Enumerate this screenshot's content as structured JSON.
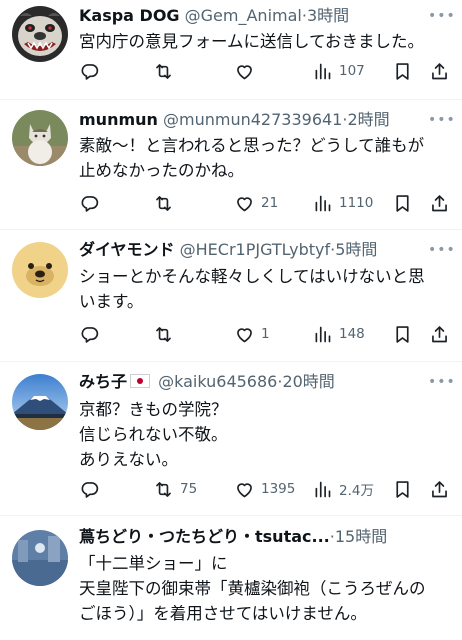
{
  "tweets": [
    {
      "display_name": "Kaspa DOG",
      "handle": "@Gem_Animal",
      "time": "3時間",
      "lines": [
        "宮内庁の意見フォームに送信しておきました。"
      ],
      "replies": "",
      "retweets": "",
      "likes": "",
      "views": "107",
      "avatar": "bulldog-avatar"
    },
    {
      "display_name": "munmun",
      "handle": "@munmun427339641",
      "time": "2時間",
      "lines": [
        "素敵〜！と言われると思った？どうして誰もが",
        "止めなかったのかね。"
      ],
      "replies": "",
      "retweets": "",
      "likes": "21",
      "views": "1110",
      "avatar": "cat-avatar"
    },
    {
      "display_name": "ダイヤモンド",
      "handle": "@HECr1PJGTLybtyf",
      "time": "5時間",
      "lines": [
        "ショーとかそんな軽々しくしてはいけないと思",
        "います。"
      ],
      "replies": "",
      "retweets": "",
      "likes": "1",
      "views": "148",
      "avatar": "bear-avatar"
    },
    {
      "display_name": "みち子",
      "flag": "japan-flag",
      "handle": "@kaiku645686",
      "time": "20時間",
      "lines": [
        "京都？きもの学院？",
        "信じられない不敬。",
        "ありえない。"
      ],
      "replies": "",
      "retweets": "75",
      "likes": "1395",
      "views": "2.4万",
      "avatar": "mount-fuji-avatar"
    },
    {
      "display_name": "蔦ちどり・つたちどり・tsutac...",
      "handle": "",
      "time": "15時間",
      "lines": [
        "「十二単ショー」に",
        "天皇陛下の御束帯「黄櫨染御袍（こうろぜんの",
        "ごほう）」を着用させてはいけません。"
      ],
      "avatar": "blue-landscape-avatar"
    }
  ],
  "separator": "·",
  "more_label": "•••",
  "colors": {
    "text": "#0f1419",
    "secondary": "#536471",
    "divider": "#eff3f4"
  }
}
